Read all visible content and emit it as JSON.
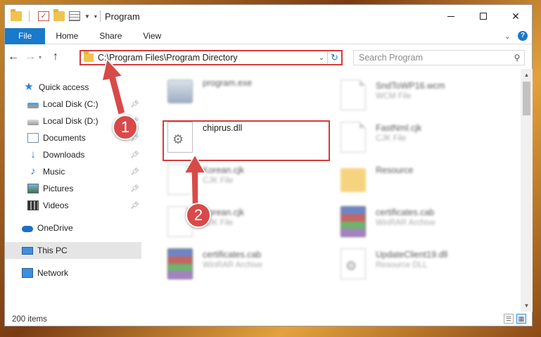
{
  "window": {
    "title": "Program",
    "title_buttons": {
      "minimize": "–",
      "maximize": "□",
      "close": "✕"
    }
  },
  "ribbon": {
    "tabs": [
      "File",
      "Home",
      "Share",
      "View"
    ],
    "help": "?"
  },
  "navbar": {
    "address": "C:\\Program Files\\Program Directory",
    "search_placeholder": "Search Program"
  },
  "sidebar": {
    "items": [
      {
        "label": "Quick access",
        "icon": "star-icon"
      },
      {
        "label": "Local Disk (C:)",
        "icon": "drive-icon",
        "pinned": true
      },
      {
        "label": "Local Disk (D:)",
        "icon": "drive-icon",
        "pinned": true
      },
      {
        "label": "Documents",
        "icon": "documents-icon",
        "pinned": true
      },
      {
        "label": "Downloads",
        "icon": "download-icon",
        "pinned": true
      },
      {
        "label": "Music",
        "icon": "music-icon",
        "pinned": true
      },
      {
        "label": "Pictures",
        "icon": "pictures-icon",
        "pinned": true
      },
      {
        "label": "Videos",
        "icon": "videos-icon",
        "pinned": true
      },
      {
        "label": "OneDrive",
        "icon": "cloud-icon"
      },
      {
        "label": "This PC",
        "icon": "computer-icon",
        "selected": true
      },
      {
        "label": "Network",
        "icon": "network-icon"
      }
    ]
  },
  "files": {
    "left": [
      {
        "name": "program.exe",
        "type": ""
      },
      {
        "name": "chiprus.dll",
        "type": ""
      },
      {
        "name": "Korean.cjk",
        "type": "CJK File"
      },
      {
        "name": "Korean.cjk",
        "type": "CJK File"
      },
      {
        "name": "certificates.cab",
        "type": "WinRAR Archive"
      }
    ],
    "right": [
      {
        "name": "SndToWP16.wcm",
        "type": "WCM File"
      },
      {
        "name": "FastNml.cjk",
        "type": "CJK File"
      },
      {
        "name": "Resource",
        "type": ""
      },
      {
        "name": "certificates.cab",
        "type": "WinRAR Archive"
      },
      {
        "name": "UpdateClient19.dll",
        "type": "Resource DLL"
      }
    ]
  },
  "status": {
    "items_count": "200 items"
  },
  "callouts": {
    "one": "1",
    "two": "2"
  },
  "colors": {
    "accent": "#1979ca",
    "highlight": "#d43b3b"
  }
}
